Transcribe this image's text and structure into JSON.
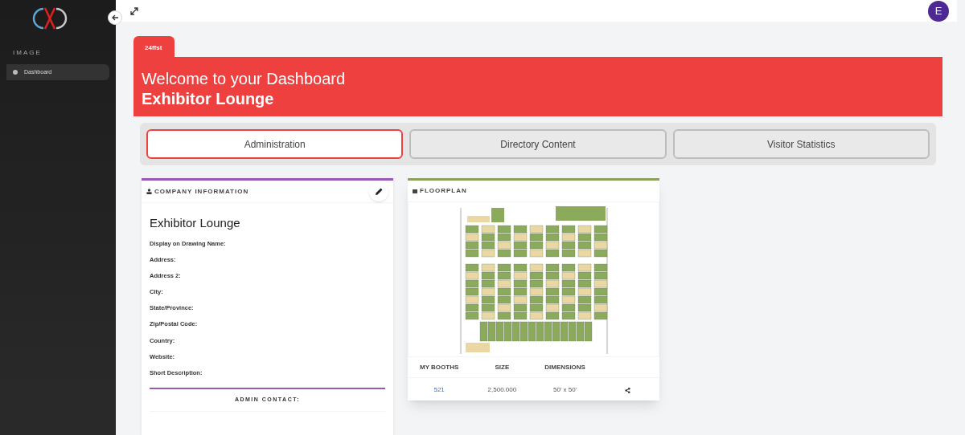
{
  "sidebar": {
    "section": "IMAGE",
    "items": [
      {
        "label": "Dashboard",
        "selected": true
      }
    ]
  },
  "topbar": {
    "avatar": "E"
  },
  "event_tab": "24ffst",
  "banner": {
    "title": "Welcome to your Dashboard",
    "subtitle": "Exhibitor Lounge"
  },
  "tabs": [
    {
      "label": "Administration",
      "selected": true
    },
    {
      "label": "Directory Content",
      "selected": false
    },
    {
      "label": "Visitor Statistics",
      "selected": false
    }
  ],
  "company": {
    "header": "COMPANY INFORMATION",
    "name": "Exhibitor Lounge",
    "fields": [
      "Display on Drawing Name:",
      "Address:",
      "Address 2:",
      "City:",
      "State/Province:",
      "Zip/Postal Code:",
      "Country:",
      "Website:",
      "Short Description:"
    ],
    "admin_contact": "ADMIN CONTACT:"
  },
  "floorplan": {
    "header": "FLOORPLAN",
    "table": {
      "columns": [
        "MY BOOTHS",
        "SIZE",
        "DIMENSIONS"
      ],
      "rows": [
        {
          "booth": "521",
          "size": "2,500.000",
          "dimensions": "50' x 50'"
        }
      ]
    }
  }
}
